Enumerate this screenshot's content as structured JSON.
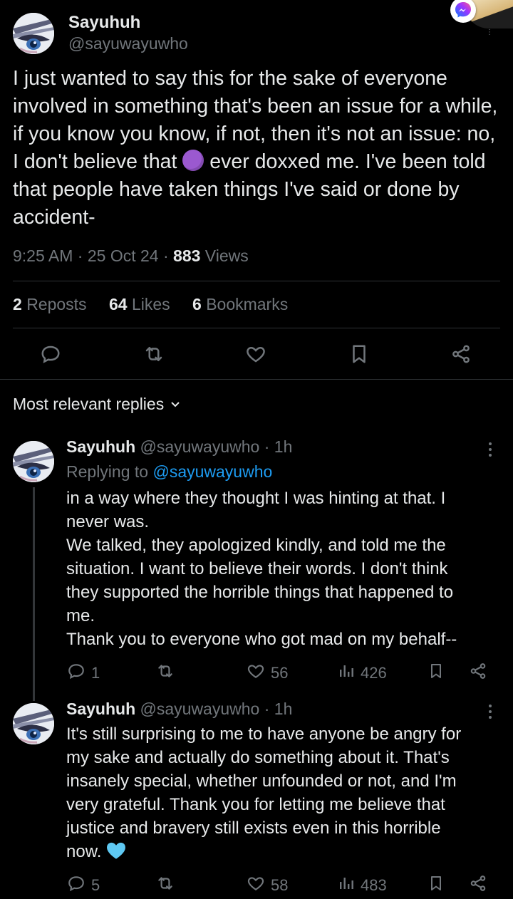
{
  "tweet": {
    "display_name": "Sayuhuh",
    "handle": "@sayuwayuwho",
    "text_before_emoji": "I just wanted to say this for the sake of everyone involved in something that's been an issue for a while, if you know you know, if not, then it's not an issue: no, I don't believe that",
    "emoji": "purple-circle",
    "text_after_emoji": "ever doxxed me. I've been told that people have taken things I've said or done by accident-",
    "time": "9:25 AM",
    "date": "25 Oct 24",
    "views_count": "883",
    "views_label": "Views",
    "reposts_count": "2",
    "reposts_label": "Reposts",
    "likes_count": "64",
    "likes_label": "Likes",
    "bookmarks_count": "6",
    "bookmarks_label": "Bookmarks",
    "sep": "·"
  },
  "actions": {
    "icons": [
      "reply-icon",
      "repost-icon",
      "like-icon",
      "bookmark-icon",
      "share-icon"
    ]
  },
  "replies_header": {
    "label": "Most relevant replies"
  },
  "replies": [
    {
      "display_name": "Sayuhuh",
      "handle": "@sayuwayuwho",
      "time": "1h",
      "replying_to_label": "Replying to",
      "replying_to_handle": "@sayuwayuwho",
      "lines": [
        "in a way where they thought I was hinting at that. I",
        "never was.",
        "We talked, they apologized kindly, and told me the",
        "situation. I want to believe their words. I don't think",
        "they supported the horrible things that happened to",
        "me.",
        "Thank you to everyone who got mad on my behalf--"
      ],
      "reply_count": "1",
      "repost_count": "",
      "like_count": "56",
      "view_count": "426"
    },
    {
      "display_name": "Sayuhuh",
      "handle": "@sayuwayuwho",
      "time": "1h",
      "lines": [
        "It's still surprising to me to have anyone be angry for",
        "my sake and actually do something about it. That's",
        "insanely special, whether unfounded or not, and I'm",
        "very grateful. Thank you for letting me believe that",
        "justice and bravery still exists even in this horrible",
        "now."
      ],
      "emoji": "light-blue-heart",
      "reply_count": "5",
      "repost_count": "",
      "like_count": "58",
      "view_count": "483"
    }
  ],
  "colors": {
    "background": "#000000",
    "text": "#e7e9ea",
    "muted": "#71767b",
    "link": "#1d9bf0",
    "divider": "#2f3336"
  }
}
